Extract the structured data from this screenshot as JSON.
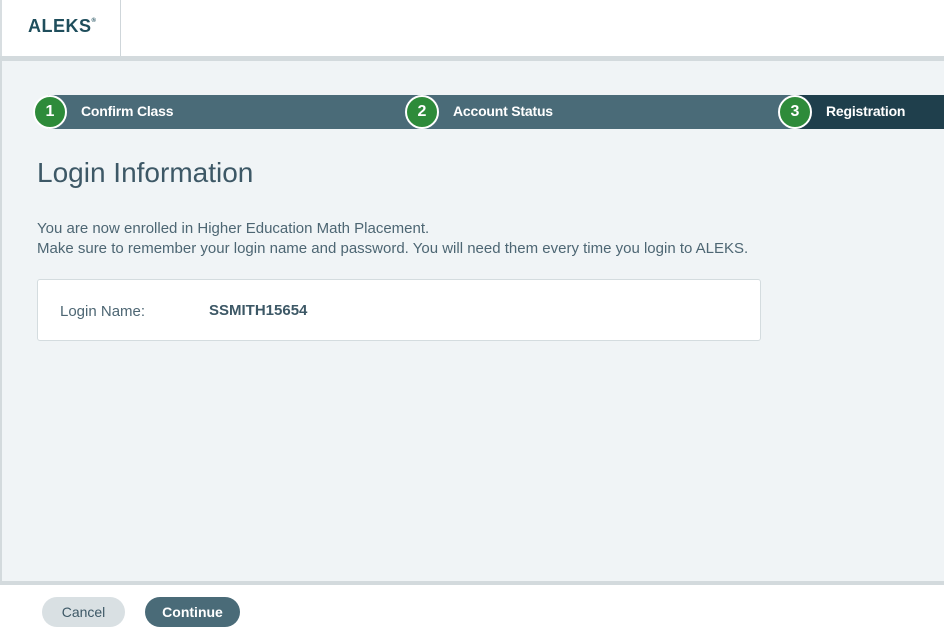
{
  "header": {
    "logo_text": "ALEKS",
    "logo_mark": "®"
  },
  "steps": [
    {
      "number": "1",
      "label": "Confirm Class"
    },
    {
      "number": "2",
      "label": "Account Status"
    },
    {
      "number": "3",
      "label": "Registration"
    }
  ],
  "page": {
    "title": "Login Information",
    "message_line1": "You are now enrolled in Higher Education Math Placement.",
    "message_line2": "Make sure to remember your login name and password. You will need them every time you login to ALEKS."
  },
  "login": {
    "label": "Login Name:",
    "value": "SSMITH15654"
  },
  "footer": {
    "cancel_label": "Cancel",
    "continue_label": "Continue"
  },
  "colors": {
    "step_bar": "#4a6b78",
    "step_active": "#1f3f4c",
    "step_circle": "#2e8b3a",
    "primary_button": "#4a6b78"
  }
}
